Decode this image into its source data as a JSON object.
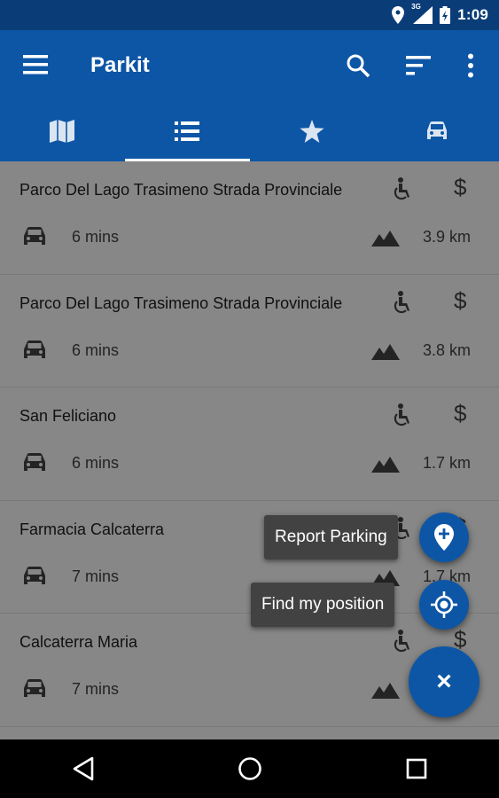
{
  "status_bar": {
    "network": "3G",
    "time": "1:09"
  },
  "app_bar": {
    "title": "Parkit"
  },
  "tabs": [
    {
      "icon": "map-icon"
    },
    {
      "icon": "list-icon",
      "active": true
    },
    {
      "icon": "star-icon"
    },
    {
      "icon": "car-icon"
    }
  ],
  "parking_list": [
    {
      "name": "Parco Del Lago Trasimeno Strada Provinciale",
      "cost": "$",
      "drive_time": "6 mins",
      "distance": "3.9 km"
    },
    {
      "name": "Parco Del Lago Trasimeno Strada Provinciale",
      "cost": "$",
      "drive_time": "6 mins",
      "distance": "3.8 km"
    },
    {
      "name": "San Feliciano",
      "cost": "$",
      "drive_time": "6 mins",
      "distance": "1.7 km"
    },
    {
      "name": "Farmacia Calcaterra",
      "cost": "$",
      "drive_time": "7 mins",
      "distance": "1.7 km"
    },
    {
      "name": "Calcaterra Maria",
      "cost": "$",
      "drive_time": "7 mins",
      "distance": ""
    }
  ],
  "fab_menu": {
    "report_parking_label": "Report Parking",
    "find_position_label": "Find my position",
    "close_glyph": "×"
  },
  "colors": {
    "primary": "#0d56a6",
    "status_bar": "#0a3d78",
    "chip": "#424242"
  }
}
